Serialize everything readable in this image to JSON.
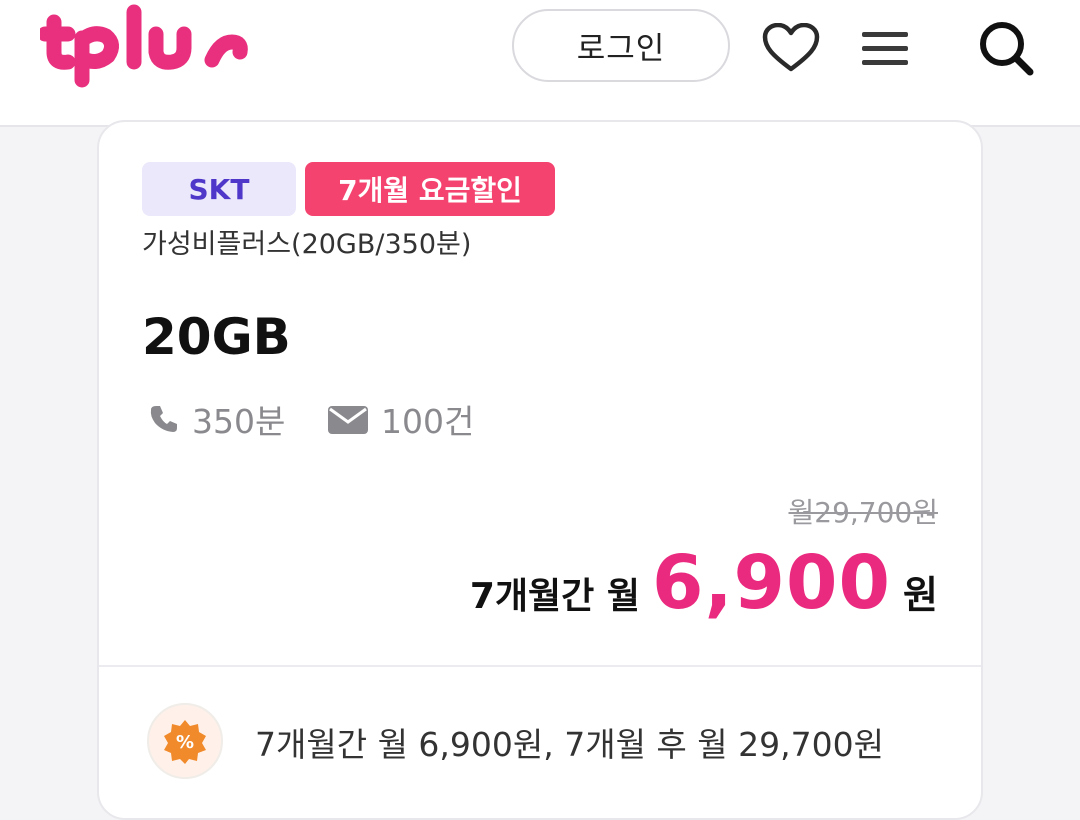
{
  "header": {
    "logo_text": "tplus",
    "login_label": "로그인",
    "icons": [
      "heart-icon",
      "menu-icon",
      "search-icon"
    ]
  },
  "plan": {
    "carrier_badge": "SKT",
    "promo_badge": "7개월 요금할인",
    "name": "가성비플러스(20GB/350분)",
    "data": "20GB",
    "voice": "350분",
    "sms": "100건",
    "original_price": "월29,700원",
    "price_label": "7개월간 월",
    "price_value": "6,900",
    "price_unit": "원",
    "promo_note": "7개월간 월 6,900원, 7개월 후 월 29,700원"
  },
  "colors": {
    "brand": "#e9307f",
    "accent_price": "#ea2a7f",
    "promo_badge_bg": "#f4436e",
    "carrier_badge_bg": "#ebe8fb",
    "carrier_badge_text": "#4e37c9",
    "discount_icon": "#f08a2a"
  }
}
